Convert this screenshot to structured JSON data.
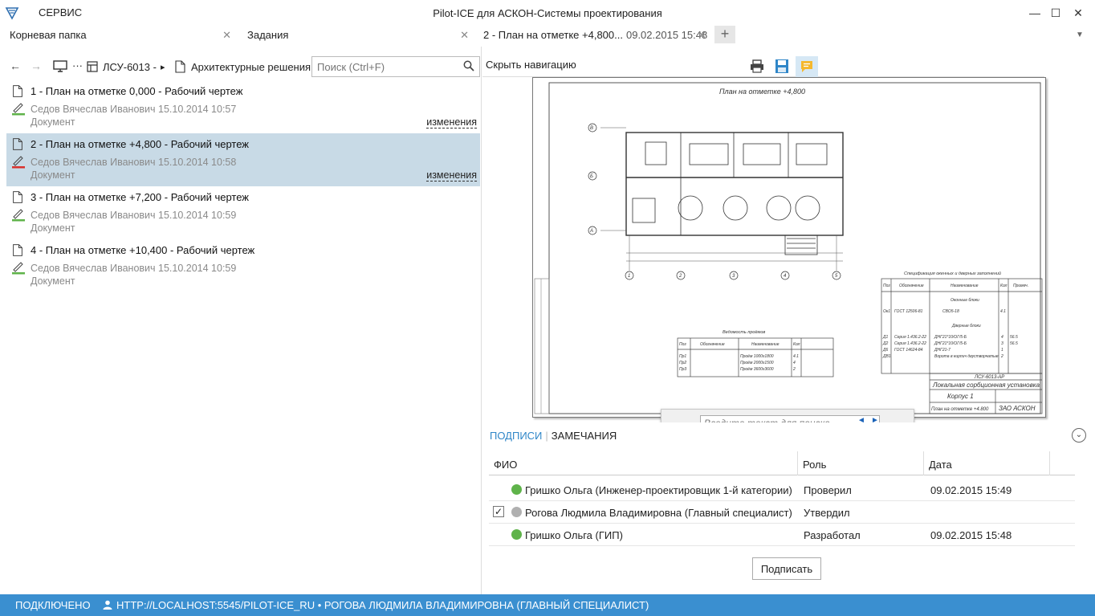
{
  "titlebar": {
    "menu_label": "СЕРВИС",
    "title": "Pilot-ICE для АСКОН-Системы проектирования",
    "minimize": "—",
    "maximize": "☐",
    "close": "✕"
  },
  "tabs": [
    {
      "label": "Корневая папка",
      "close": "✕"
    },
    {
      "label": "Задания",
      "close": "✕"
    },
    {
      "label": "2 - План на отметке +4,800...",
      "sub": "09.02.2015 15:48",
      "close": "✕"
    }
  ],
  "tab_add": "+",
  "tab_overflow": "▼",
  "navigation": {
    "back": "←",
    "forward": "→",
    "ellipsis": "···",
    "crumb1": "ЛСУ-6013 -",
    "arrow": "▸",
    "crumb2": "Архитектурные решения",
    "search_placeholder": "Поиск (Ctrl+F)"
  },
  "documents": [
    {
      "name": "1 - План на отметке 0,000 - Рабочий чертеж",
      "author": "Седов Вячеслав Иванович 15.10.2014 10:57",
      "type": "Документ",
      "changes": "изменения",
      "selected": false,
      "sign_color": "#5fb34a"
    },
    {
      "name": "2 - План на отметке +4,800 - Рабочий чертеж",
      "author": "Седов Вячеслав Иванович 15.10.2014 10:58",
      "type": "Документ",
      "changes": "изменения",
      "selected": true,
      "sign_color": "#d9322e"
    },
    {
      "name": "3 - План на отметке +7,200  - Рабочий чертеж",
      "author": "Седов Вячеслав Иванович 15.10.2014 10:59",
      "type": "Документ",
      "changes": "",
      "selected": false,
      "sign_color": "#5fb34a"
    },
    {
      "name": "4 - План на отметке +10,400 - Рабочий чертеж",
      "author": "Седов Вячеслав Иванович 15.10.2014 10:59",
      "type": "Документ",
      "changes": "",
      "selected": false,
      "sign_color": "#5fb34a"
    }
  ],
  "viewer": {
    "hide_nav": "Скрыть навигацию",
    "search_placeholder": "Введите текст для поиска...",
    "prev": "◄",
    "next": "►",
    "drawing": {
      "plan_title": "План на отметке +4,800",
      "axes_letters": [
        "В",
        "Б",
        "А"
      ],
      "axes_numbers": [
        "1",
        "2",
        "3",
        "4",
        "5"
      ],
      "spec_title": "Спецификация окенных и дверных заполнений",
      "spec_headers": [
        "Поз",
        "Обозначение",
        "Наименование",
        "Кол",
        "Примеч."
      ],
      "spec_section1": "Оконные блоки",
      "spec_row1": [
        "Ок1",
        "ГОСТ 12506-81",
        "СВО5-18",
        "4.1"
      ],
      "spec_section2": "Дверные блоки",
      "spec_rows": [
        [
          "Д1",
          "Серия 1.436.2-22",
          "ДНГ21*10/ОГ/5-Б",
          "4",
          "56.5"
        ],
        [
          "Д2",
          "Серия 1.436.2-22",
          "ДНГ21*10/ОГ/5-Б",
          "3",
          "56.5"
        ],
        [
          "Д6",
          "ГОСТ 14624-84",
          "ДНГ21-7",
          "1",
          ""
        ],
        [
          "ДВ1",
          "",
          "Ворота в кирпич двустворчатые",
          "2",
          ""
        ]
      ],
      "openings_title": "Ведомость проёмов",
      "openings_headers": [
        "Поз",
        "Обозначение",
        "Наименование",
        "Кол"
      ],
      "openings_rows": [
        [
          "Пр1",
          "",
          "Проём 1000х1800",
          "4.1"
        ],
        [
          "Пр2",
          "",
          "Проём 2000х1500",
          "4"
        ],
        [
          "Пр3",
          "",
          "Проём 3600х3600",
          "2"
        ]
      ],
      "stamp_code": "ЛСУ-6013-АР",
      "stamp_name": "Локальная сорбционная установка",
      "stamp_building": "Корпус 1",
      "stamp_sheet": "План на отметке +4.800",
      "stamp_company": "ЗАО АСКОН"
    }
  },
  "signatures": {
    "tab_signatures": "ПОДПИСИ",
    "tab_remarks": "ЗАМЕЧАНИЯ",
    "collapse": "⌄",
    "col_name": "ФИО",
    "col_role": "Роль",
    "col_date": "Дата",
    "rows": [
      {
        "checkbox": false,
        "status": "ok",
        "name": "Гришко Ольга (Инженер-проектировщик 1-й категории)",
        "role": "Проверил",
        "date": "09.02.2015 15:49"
      },
      {
        "checkbox": true,
        "status": "wait",
        "name": "Рогова Людмила Владимировна (Главный специалист)",
        "role": "Утвердил",
        "date": ""
      },
      {
        "checkbox": false,
        "status": "ok",
        "name": "Гришко Ольга (ГИП)",
        "role": "Разработал",
        "date": "09.02.2015 15:48"
      }
    ],
    "check_mark": "✓",
    "sign_button": "Подписать"
  },
  "statusbar": {
    "connection": "ПОДКЛЮЧЕНО",
    "user": "HTTP://LOCALHOST:5545/PILOT-ICE_RU • РОГОВА ЛЮДМИЛА ВЛАДИМИРОВНА (ГЛАВНЫЙ СПЕЦИАЛИСТ)"
  },
  "colors": {
    "accent": "#3a8fd0",
    "selection": "#c8dae6",
    "signed": "#5fb34a",
    "link": "#2f86c8"
  }
}
